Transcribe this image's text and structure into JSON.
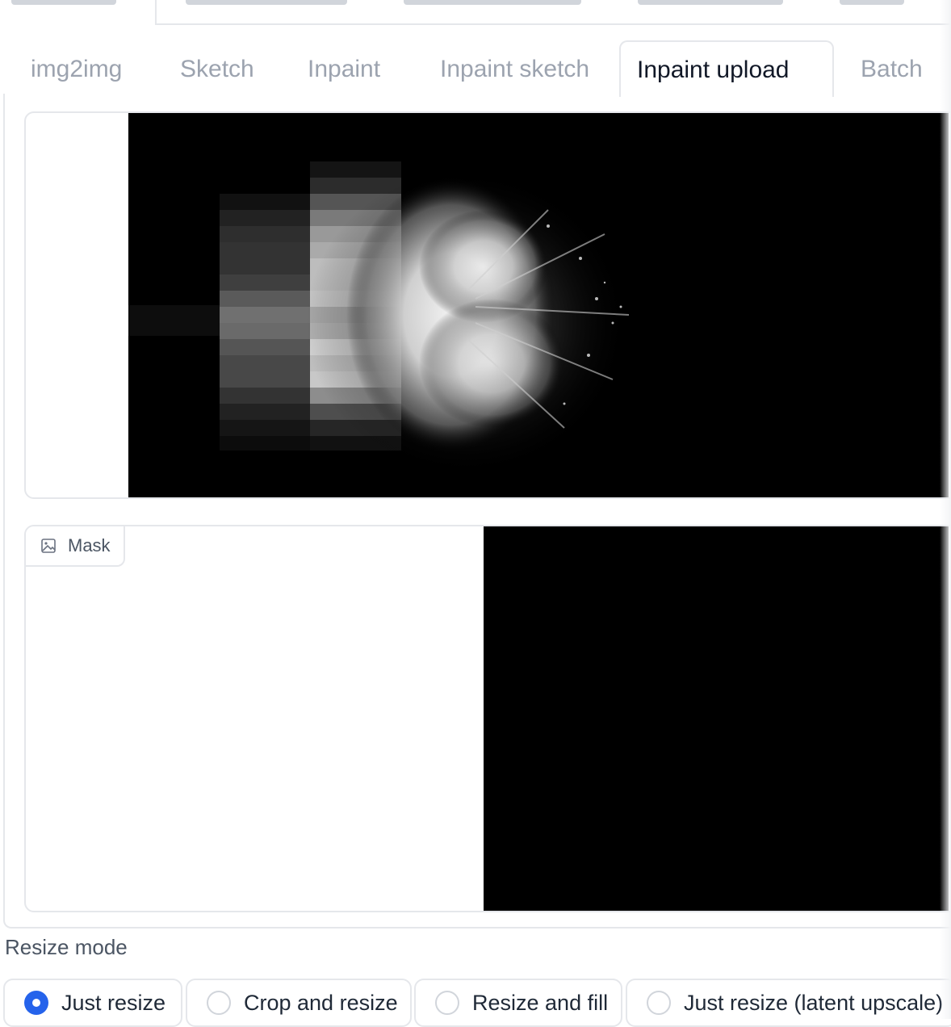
{
  "tabs": [
    {
      "label": "img2img",
      "active": false
    },
    {
      "label": "Sketch",
      "active": false
    },
    {
      "label": "Inpaint",
      "active": false
    },
    {
      "label": "Inpaint sketch",
      "active": false
    },
    {
      "label": "Inpaint upload",
      "active": true
    },
    {
      "label": "Batch",
      "active": false
    }
  ],
  "mask": {
    "label": "Mask",
    "icon": "image-icon"
  },
  "resize_mode": {
    "title": "Resize mode",
    "options": [
      {
        "label": "Just resize",
        "checked": true
      },
      {
        "label": "Crop and resize",
        "checked": false
      },
      {
        "label": "Resize and fill",
        "checked": false
      },
      {
        "label": "Just resize (latent upscale)",
        "checked": false
      }
    ]
  },
  "colors": {
    "accent": "#2563eb",
    "border": "#e5e7eb",
    "muted_text": "#9ca3af"
  }
}
